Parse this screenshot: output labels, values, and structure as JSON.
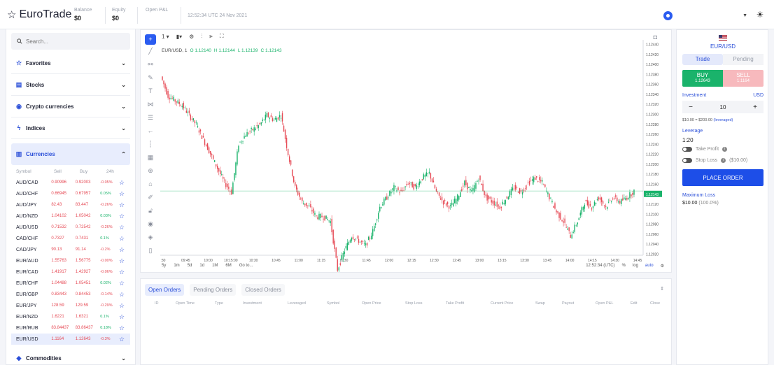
{
  "header": {
    "logo_text": "EuroTrade",
    "balance_label": "Balance",
    "balance_value": "$0",
    "equity_label": "Equity",
    "equity_value": "$0",
    "pnl_label": "Open P&L",
    "time": "12:52:34 UTC 24 Nov 2021"
  },
  "sidebar": {
    "search_placeholder": "Search...",
    "categories": [
      {
        "label": "Favorites",
        "icon": "star-icon"
      },
      {
        "label": "Stocks",
        "icon": "stocks-icon"
      },
      {
        "label": "Crypto currencies",
        "icon": "crypto-icon"
      },
      {
        "label": "Indices",
        "icon": "indices-icon"
      },
      {
        "label": "Currencies",
        "icon": "currencies-icon"
      },
      {
        "label": "Commodities",
        "icon": "commodities-icon"
      }
    ],
    "market_headers": {
      "symbol": "Symbol",
      "sell": "Sell",
      "buy": "Buy",
      "change": "24h"
    },
    "markets": [
      {
        "symbol": "AUD/CAD",
        "sell": "0.90996",
        "buy": "0.92003",
        "change": "-0.05%",
        "dir": "neg"
      },
      {
        "symbol": "AUD/CHF",
        "sell": "0.66945",
        "buy": "0.67957",
        "change": "0.05%",
        "dir": "pos"
      },
      {
        "symbol": "AUD/JPY",
        "sell": "82.43",
        "buy": "83.447",
        "change": "-0.26%",
        "dir": "neg"
      },
      {
        "symbol": "AUD/NZD",
        "sell": "1.04102",
        "buy": "1.05042",
        "change": "0.03%",
        "dir": "pos"
      },
      {
        "symbol": "AUD/USD",
        "sell": "0.71532",
        "buy": "0.72542",
        "change": "-0.26%",
        "dir": "neg"
      },
      {
        "symbol": "CAD/CHF",
        "sell": "0.7327",
        "buy": "0.7431",
        "change": "0.1%",
        "dir": "pos"
      },
      {
        "symbol": "CAD/JPY",
        "sell": "90.13",
        "buy": "91.14",
        "change": "-0.2%",
        "dir": "neg"
      },
      {
        "symbol": "EUR/AUD",
        "sell": "1.55763",
        "buy": "1.56775",
        "change": "-0.00%",
        "dir": "neg"
      },
      {
        "symbol": "EUR/CAD",
        "sell": "1.41917",
        "buy": "1.42927",
        "change": "-0.06%",
        "dir": "neg"
      },
      {
        "symbol": "EUR/CHF",
        "sell": "1.04488",
        "buy": "1.05451",
        "change": "0.02%",
        "dir": "pos"
      },
      {
        "symbol": "EUR/GBP",
        "sell": "0.83443",
        "buy": "0.84453",
        "change": "-0.14%",
        "dir": "neg"
      },
      {
        "symbol": "EUR/JPY",
        "sell": "128.59",
        "buy": "129.59",
        "change": "-0.29%",
        "dir": "neg"
      },
      {
        "symbol": "EUR/NZD",
        "sell": "1.6221",
        "buy": "1.6321",
        "change": "0.1%",
        "dir": "pos"
      },
      {
        "symbol": "EUR/RUB",
        "sell": "83.84437",
        "buy": "83.86437",
        "change": "0.18%",
        "dir": "pos"
      },
      {
        "symbol": "EUR/USD",
        "sell": "1.1164",
        "buy": "1.12643",
        "change": "-0.3%",
        "dir": "neg"
      }
    ]
  },
  "chart": {
    "interval": "1",
    "symbol_label": "EUR/USD, 1",
    "ohlc": {
      "o": "O 1.12140",
      "h": "H 1.12144",
      "l": "L 1.12139",
      "c": "C 1.12143"
    },
    "price_ticks": [
      "1.12440",
      "1.12420",
      "1.12400",
      "1.12380",
      "1.12360",
      "1.12340",
      "1.12320",
      "1.12300",
      "1.12280",
      "1.12260",
      "1.12240",
      "1.12220",
      "1.12200",
      "1.12180",
      "1.12160",
      "1.12143",
      "1.12120",
      "1.12100",
      "1.12080",
      "1.12060",
      "1.12040",
      "1.12020"
    ],
    "current_price": "1.12143",
    "time_ticks": [
      ":30",
      "09:45",
      "10:00",
      "10:15:00",
      "10:30",
      "10:45",
      "11:00",
      "11:15",
      "11:30",
      "11:45",
      "12:00",
      "12:15",
      "12:30",
      "12:45",
      "13:00",
      "13:15",
      "13:30",
      "13:45",
      "14:00",
      "14:15",
      "14:30",
      "14:45"
    ],
    "ranges": [
      "5y",
      "1m",
      "5d",
      "1d",
      "1M",
      "6M",
      "Go to..."
    ],
    "footer_time": "12:52:34 (UTC)",
    "footer_pct": "%",
    "footer_log": "log",
    "footer_auto": "auto",
    "colors": {
      "up": "#1ab36b",
      "down": "#e64a55"
    }
  },
  "chart_data": {
    "type": "candlestick",
    "ylim": [
      1.1201,
      1.1245
    ],
    "close_series": [
      1.1238,
      1.1234,
      1.1233,
      1.1232,
      1.123,
      1.1228,
      1.1225,
      1.1222,
      1.1219,
      1.1216,
      1.1214,
      1.1224,
      1.1226,
      1.1227,
      1.1228,
      1.123,
      1.1229,
      1.123,
      1.1222,
      1.1215,
      1.1212,
      1.1211,
      1.1209,
      1.1209,
      1.1208,
      1.1198,
      1.1202,
      1.1205,
      1.1204,
      1.1203,
      1.1206,
      1.1211,
      1.1213,
      1.1215,
      1.1214,
      1.1216,
      1.1215,
      1.1217,
      1.1218,
      1.1214,
      1.1212,
      1.1211,
      1.1213,
      1.1216,
      1.1214,
      1.1217,
      1.1213,
      1.1212,
      1.1211,
      1.1213,
      1.1215,
      1.1214,
      1.1216,
      1.1217,
      1.1216,
      1.1213,
      1.121,
      1.1208,
      1.1205,
      1.1208,
      1.1212,
      1.1211,
      1.1213,
      1.1211,
      1.1213,
      1.1212,
      1.1213,
      1.12143
    ]
  },
  "orders": {
    "tabs": [
      "Open Orders",
      "Pending Orders",
      "Closed Orders"
    ],
    "columns": [
      "ID",
      "Open Time",
      "Type",
      "Investment",
      "Leveraged",
      "Symbol",
      "Open Price",
      "Stop Loss",
      "Take Profit",
      "Current Price",
      "Swap",
      "Payout",
      "Open P&L",
      "Edit",
      "Close"
    ]
  },
  "trade": {
    "pair": "EUR/USD",
    "tab_trade": "Trade",
    "tab_pending": "Pending",
    "buy_label": "BUY",
    "buy_price": "1.12643",
    "sell_label": "SELL",
    "sell_price": "1.1164",
    "investment_label": "Investment",
    "currency": "USD",
    "investment_value": "10",
    "minus": "−",
    "plus": "+",
    "hint": "$10.00 = $200.00",
    "hint_lev": "(leveraged)",
    "leverage_label": "Leverage",
    "leverage_value": "1:20",
    "take_profit_label": "Take Profit",
    "stop_loss_label": "Stop Loss",
    "stop_loss_value": "($10.00)",
    "place_order": "PLACE ORDER",
    "max_loss_label": "Maximum Loss",
    "max_loss_value": "$10.00",
    "max_loss_pct": "(100.0%)"
  }
}
